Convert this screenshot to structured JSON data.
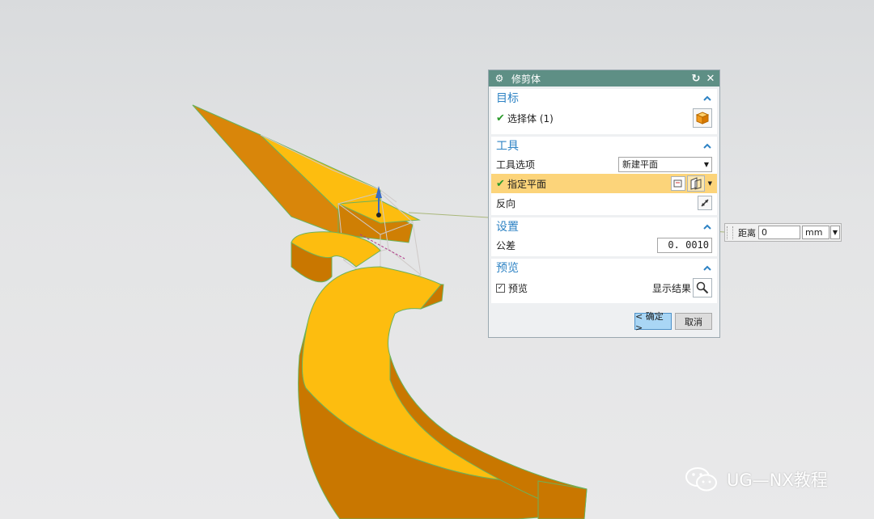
{
  "dialog": {
    "title": "修剪体",
    "sections": {
      "target": {
        "title": "目标",
        "select_body_label": "选择体 (1)"
      },
      "tool": {
        "title": "工具",
        "tool_option_label": "工具选项",
        "tool_option_value": "新建平面",
        "specify_plane_label": "指定平面",
        "reverse_label": "反向"
      },
      "settings": {
        "title": "设置",
        "tolerance_label": "公差",
        "tolerance_value": "0. 0010"
      },
      "preview": {
        "title": "预览",
        "preview_label": "预览",
        "preview_checked": true,
        "show_result_label": "显示结果"
      }
    },
    "ok_label": "< 确定 >",
    "cancel_label": "取消"
  },
  "distance_popup": {
    "label": "距离",
    "value": "0",
    "unit": "mm"
  },
  "watermark": {
    "text": "UG—NX教程"
  },
  "colors": {
    "title_bar": "#5e8f85",
    "section_title": "#2e83c4",
    "highlight_row": "#fcd47a",
    "body_top": "#fdbd0f",
    "body_side": "#c87a00",
    "edge": "#5db04f"
  }
}
